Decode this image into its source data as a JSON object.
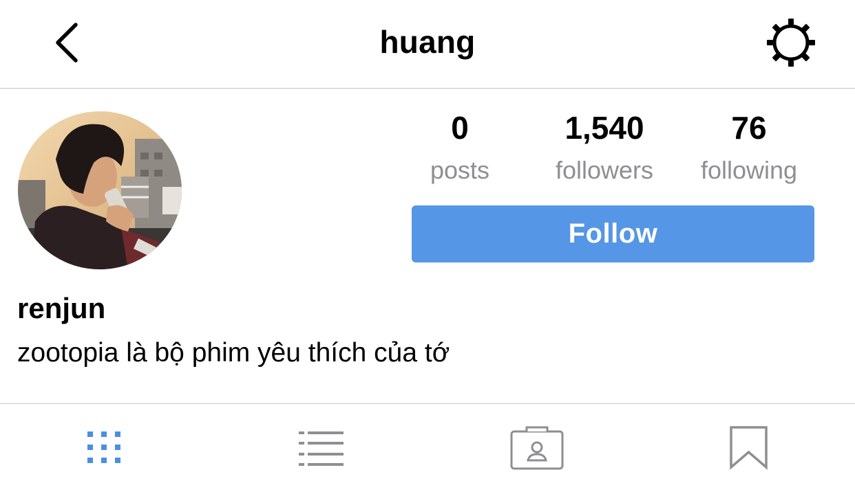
{
  "header": {
    "back_icon": "chevron-left-icon",
    "title": "huang",
    "settings_icon": "gear-icon"
  },
  "profile": {
    "avatar": "profile-photo",
    "stats": {
      "posts": {
        "value": "0",
        "label": "posts"
      },
      "followers": {
        "value": "1,540",
        "label": "followers"
      },
      "following": {
        "value": "76",
        "label": "following"
      }
    },
    "follow_label": "Follow",
    "name": "renjun",
    "bio": "zootopia là bộ phim yêu thích của tớ"
  },
  "tabs": [
    {
      "icon": "grid-icon",
      "active": true
    },
    {
      "icon": "list-icon",
      "active": false
    },
    {
      "icon": "tagged-icon",
      "active": false
    },
    {
      "icon": "bookmark-icon",
      "active": false
    }
  ],
  "colors": {
    "accent": "#5596e6",
    "active_tab": "#4a90e2",
    "inactive_tab": "#8e8e93",
    "secondary_text": "#8e8e93"
  }
}
